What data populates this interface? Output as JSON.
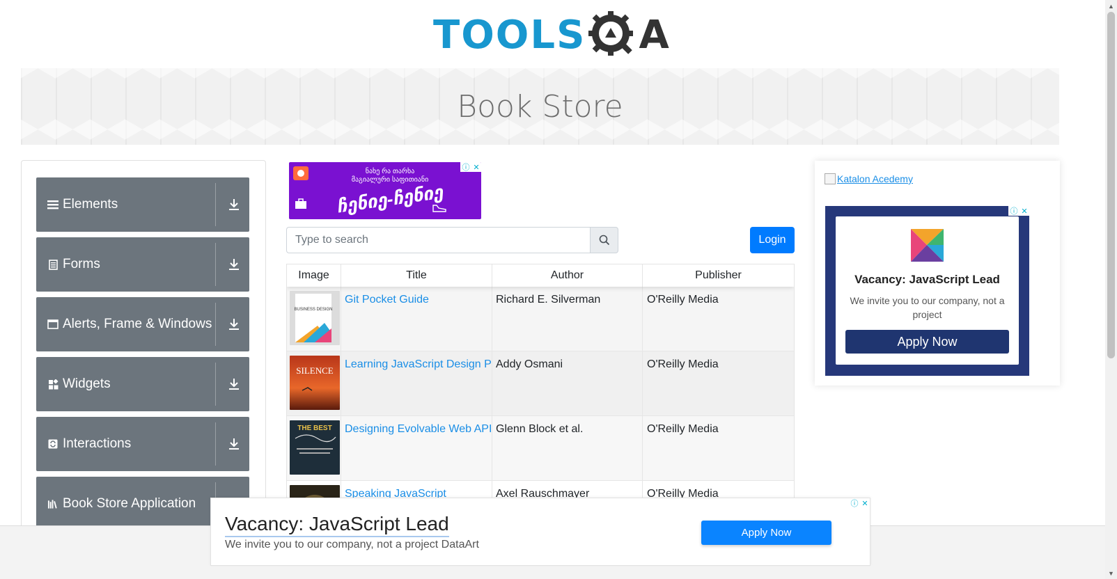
{
  "header": {
    "logo_text": "TOOLS",
    "logo_suffix": "A"
  },
  "banner": {
    "title": "Book Store"
  },
  "menu": {
    "groups": [
      {
        "label": "Elements",
        "icon": "hamburger-icon"
      },
      {
        "label": "Forms",
        "icon": "document-icon"
      },
      {
        "label": "Alerts, Frame & Windows",
        "icon": "window-icon"
      },
      {
        "label": "Widgets",
        "icon": "widgets-icon"
      },
      {
        "label": "Interactions",
        "icon": "interactions-icon"
      },
      {
        "label": "Book Store Application",
        "icon": "books-icon"
      }
    ]
  },
  "top_ad": {
    "line1": "ნახე რა თარხა",
    "line2": "მაგიალური საფითიანი",
    "big": "ჩენიე-ჩენიე"
  },
  "search": {
    "placeholder": "Type to search"
  },
  "login": {
    "label": "Login"
  },
  "table": {
    "headers": [
      "Image",
      "Title",
      "Author",
      "Publisher"
    ],
    "rows": [
      {
        "title": "Git Pocket Guide",
        "author": "Richard E. Silverman",
        "publisher": "O'Reilly Media",
        "cover_text": "BUSINESS DESIGN"
      },
      {
        "title": "Learning JavaScript Design Patterns",
        "author": "Addy Osmani",
        "publisher": "O'Reilly Media",
        "cover_text": "SILENCE"
      },
      {
        "title": "Designing Evolvable Web APIs with ASP.NET",
        "author": "Glenn Block et al.",
        "publisher": "O'Reilly Media",
        "cover_text": "THE BEST"
      },
      {
        "title": "Speaking JavaScript",
        "author": "Axel Rauschmayer",
        "publisher": "O'Reilly Media",
        "cover_text": ""
      }
    ]
  },
  "right_ad": {
    "link_text": "Katalon Acedemy",
    "title": "Vacancy: JavaScript Lead",
    "subtitle": "We invite you to our company, not a project",
    "button": "Apply Now"
  },
  "bottom_ad": {
    "title": "Vacancy: JavaScript Lead",
    "subtitle": "We invite you to our company, not a project DataArt",
    "button": "Apply Now"
  },
  "colors": {
    "brand_blue": "#1897cf",
    "menu_gray": "#6c757d",
    "primary": "#007bff",
    "dataart_navy": "#26387a"
  }
}
